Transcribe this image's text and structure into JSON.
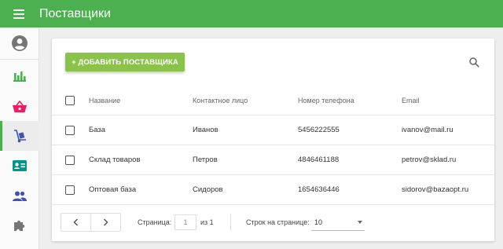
{
  "app": {
    "title": "Поставщики"
  },
  "toolbar": {
    "add_label": "+ ДОБАВИТЬ ПОСТАВЩИКА"
  },
  "table": {
    "columns": [
      "Название",
      "Контактное лицо",
      "Номер телефона",
      "Email"
    ],
    "rows": [
      [
        "База",
        "Иванов",
        "5456222555",
        "ivanov@mail.ru"
      ],
      [
        "Склад товаров",
        "Петров",
        "4846461188",
        "petrov@sklad.ru"
      ],
      [
        "Оптовая база",
        "Сидоров",
        "1654636446",
        "sidorov@bazaopt.ru"
      ]
    ]
  },
  "pagination": {
    "page_label": "Страница:",
    "page_value": "1",
    "of_label": "из 1",
    "rows_label": "Строк на странице:",
    "rows_value": "10"
  },
  "sidebar": {
    "items": [
      {
        "icon": "account-circle-icon"
      },
      {
        "icon": "bar-chart-icon"
      },
      {
        "icon": "basket-icon"
      },
      {
        "icon": "hand-truck-icon",
        "active": true
      },
      {
        "icon": "contact-card-icon"
      },
      {
        "icon": "people-icon"
      },
      {
        "icon": "puzzle-icon"
      }
    ]
  },
  "colors": {
    "topbar": "#4caf50",
    "add_button": "#8bc34a",
    "icon_green": "#4caf50",
    "icon_pink": "#e91e63",
    "icon_blue": "#3f51b5",
    "icon_gray": "#757575"
  }
}
